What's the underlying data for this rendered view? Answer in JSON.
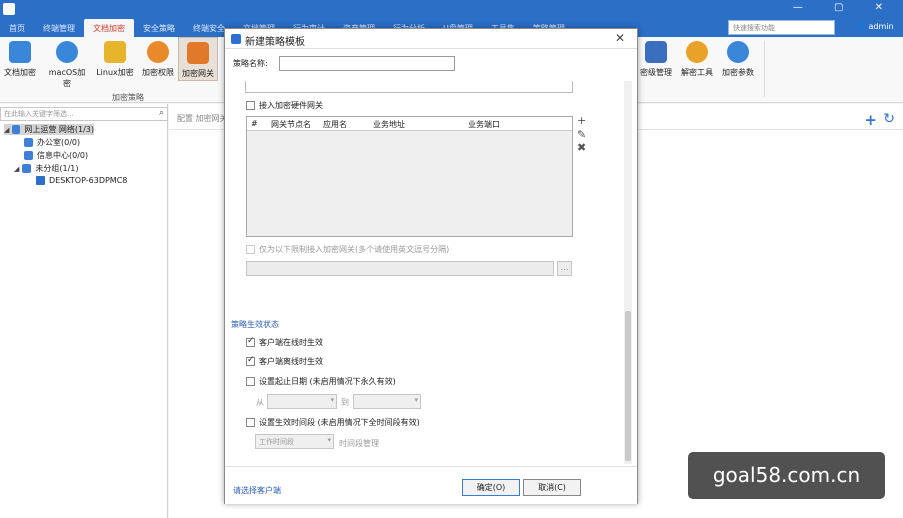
{
  "tabs": [
    "首页",
    "终端管理",
    "文档加密",
    "安全策略",
    "终端安全",
    "文档管理",
    "行为审计",
    "资产管理",
    "行为分析",
    "U盘管理",
    "工具集",
    "策略管理"
  ],
  "active_tab_index": 2,
  "search_placeholder": "快速搜索功能",
  "user_label": "admin",
  "ribbon_buttons": [
    {
      "label": "文档加密",
      "color": "#3a86d8"
    },
    {
      "label": "macOS加密",
      "color": "#3a86d8"
    },
    {
      "label": "Linux加密",
      "color": "#e6b52b"
    },
    {
      "label": "加密权限",
      "color": "#e98a2a"
    },
    {
      "label": "加密网关",
      "color": "#d9d9d9"
    },
    {
      "label": "密级管理",
      "color": "#3a6fc0"
    },
    {
      "label": "解密工具",
      "color": "#e8a22a"
    },
    {
      "label": "加密参数",
      "color": "#3a86d8"
    }
  ],
  "ribbon_group_label": "加密策略",
  "left": {
    "filter_placeholder": "在此输入关键字筛选...",
    "tree": [
      {
        "label": "网上运营 网络(1/3)",
        "level": 0
      },
      {
        "label": "办公室(0/0)",
        "level": 1
      },
      {
        "label": "信息中心(0/0)",
        "level": 1
      },
      {
        "label": "未分组(1/1)",
        "level": 1
      },
      {
        "label": "DESKTOP-63DPMC8",
        "level": 2
      }
    ]
  },
  "right": {
    "toolbar_text": "配置 加密网关"
  },
  "dialog": {
    "title": "新建策略模板",
    "name_label": "策略名称:",
    "name_value": "",
    "gateway_checkbox": "接入加密硬件网关",
    "table_headers": [
      "#",
      "网关节点名",
      "应用名",
      "业务地址",
      "业务端口"
    ],
    "only_gateway_text": "仅为以下限制接入加密网关(多个请使用英文逗号分隔)",
    "section_title": "策略生效状态",
    "opt_online": "客户端在线时生效",
    "opt_offline": "客户端离线时生效",
    "opt_date": "设置起止日期 (未启用情况下永久有效)",
    "from_label": "从",
    "to_label": "到",
    "opt_time": "设置生效时间段 (未启用情况下全时间段有效)",
    "time_select": "工作时间段",
    "time_manage": "时间段管理",
    "footer_link": "请选择客户端",
    "ok_label": "确定(O)",
    "cancel_label": "取消(C)"
  },
  "watermark": "goal58.com.cn"
}
